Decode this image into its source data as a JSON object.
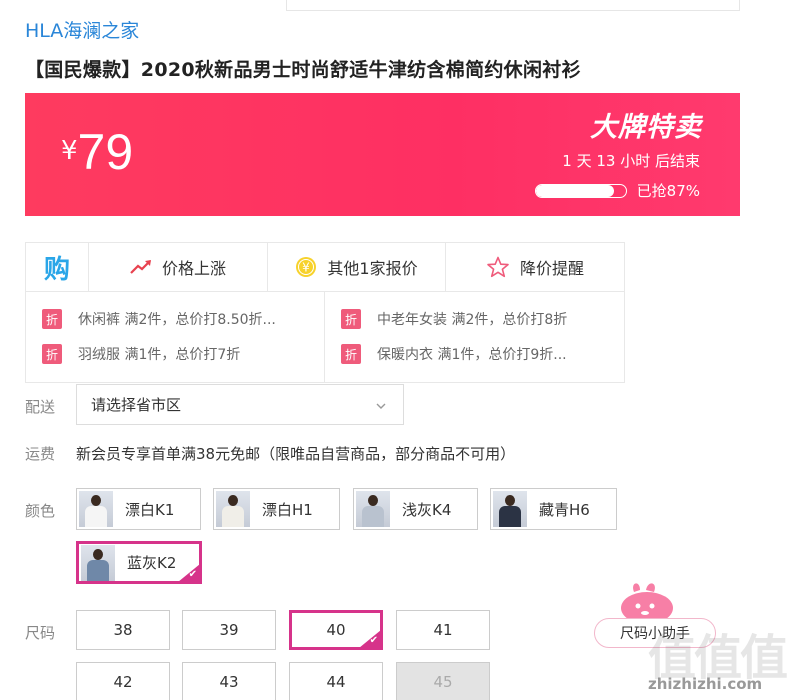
{
  "brand": "HLA海澜之家",
  "product_title": "【国民爆款】2020秋新品男士时尚舒适牛津纺含棉简约休闲衬衫",
  "price": {
    "currency": "¥",
    "amount": "79"
  },
  "sale": {
    "badge": "大牌特卖",
    "countdown": "1 天 13 小时 后结束",
    "progress_text": "已抢87%",
    "progress_percent": 87
  },
  "tools": {
    "gou_glyph": "购",
    "items": [
      {
        "label": "价格上涨",
        "icon": "trend-up-icon"
      },
      {
        "label": "其他1家报价",
        "icon": "yen-coin-icon"
      },
      {
        "label": "降价提醒",
        "icon": "star-outline-icon"
      }
    ]
  },
  "promotions": {
    "badge": "折",
    "left": [
      "休闲裤 满2件，总价打8.50折...",
      "羽绒服 满1件，总价打7折"
    ],
    "right": [
      "中老年女装 满2件，总价打8折",
      "保暖内衣 满1件，总价打9折..."
    ]
  },
  "delivery": {
    "label": "配送",
    "placeholder": "请选择省市区"
  },
  "shipping": {
    "label": "运费",
    "text": "新会员专享首单满38元免邮（限唯品自营商品，部分商品不可用）"
  },
  "color": {
    "label": "颜色",
    "options": [
      "漂白K1",
      "漂白H1",
      "浅灰K4",
      "藏青H6",
      "蓝灰K2"
    ],
    "selected": "蓝灰K2"
  },
  "size": {
    "label": "尺码",
    "options": [
      "38",
      "39",
      "40",
      "41",
      "42",
      "43",
      "44",
      "45"
    ],
    "selected": "40",
    "disabled": [
      "45"
    ]
  },
  "helper": {
    "label": "尺码小助手"
  },
  "watermark": {
    "logo": "值值值",
    "text": "zhizhizhi.com"
  },
  "colors": {
    "accent": "#fe3b5f",
    "select": "#d6338a",
    "brand": "#2a86d8"
  }
}
